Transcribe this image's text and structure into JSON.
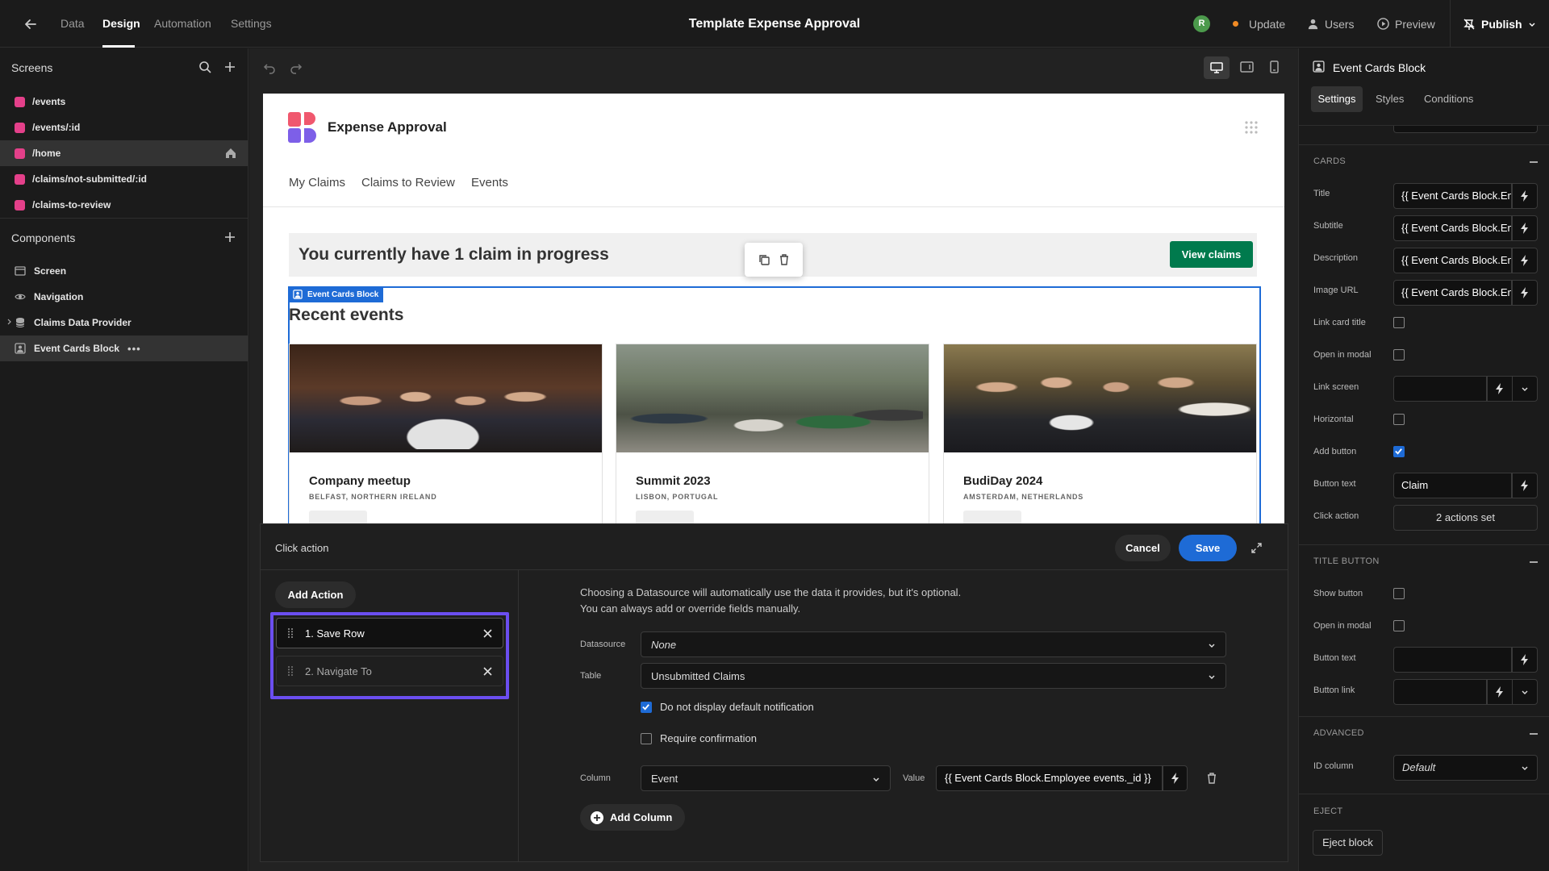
{
  "topbar": {
    "tabs": [
      "Data",
      "Design",
      "Automation",
      "Settings"
    ],
    "active_tab": "Design",
    "app_title": "Template Expense Approval",
    "avatar_initial": "R",
    "update_label": "Update",
    "users_label": "Users",
    "preview_label": "Preview",
    "publish_label": "Publish"
  },
  "screens": {
    "title": "Screens",
    "items": [
      "/events",
      "/events/:id",
      "/home",
      "/claims/not-submitted/:id",
      "/claims-to-review"
    ],
    "selected": "/home"
  },
  "components": {
    "title": "Components",
    "items": [
      "Screen",
      "Navigation",
      "Claims Data Provider",
      "Event Cards Block"
    ],
    "selected": "Event Cards Block"
  },
  "preview": {
    "app_name": "Expense Approval",
    "nav": [
      "My Claims",
      "Claims to Review",
      "Events"
    ],
    "banner_text": "You currently have 1 claim in progress",
    "view_claims_label": "View claims",
    "block_tag": "Event Cards Block",
    "section_title": "Recent events",
    "cards": [
      {
        "title": "Company meetup",
        "subtitle": "BELFAST, NORTHERN IRELAND"
      },
      {
        "title": "Summit 2023",
        "subtitle": "LISBON, PORTUGAL"
      },
      {
        "title": "BudiDay 2024",
        "subtitle": "AMSTERDAM, NETHERLANDS"
      }
    ]
  },
  "inspector": {
    "component_name": "Event Cards Block",
    "tabs": [
      "Settings",
      "Styles",
      "Conditions"
    ],
    "cards_section": "CARDS",
    "title_label": "Title",
    "title_value": "{{ Event Cards Block.Employee events.Name }}",
    "subtitle_label": "Subtitle",
    "subtitle_value": "{{ Event Cards Block.Employee events.Location }}",
    "description_label": "Description",
    "description_value": "{{ Event Cards Block.Employee events.Description }}",
    "image_label": "Image URL",
    "image_value": "{{ Event Cards Block.Employee events.Image }}",
    "link_card_title_label": "Link card title",
    "open_in_modal_label": "Open in modal",
    "link_screen_label": "Link screen",
    "horizontal_label": "Horizontal",
    "add_button_label": "Add button",
    "button_text_label": "Button text",
    "button_text_value": "Claim",
    "click_action_label": "Click action",
    "click_action_value": "2 actions set",
    "title_button_section": "TITLE BUTTON",
    "show_button_label": "Show button",
    "tb_open_in_modal_label": "Open in modal",
    "tb_button_text_label": "Button text",
    "tb_button_link_label": "Button link",
    "advanced_section": "ADVANCED",
    "id_column_label": "ID column",
    "id_column_value": "Default",
    "eject_section": "EJECT",
    "eject_button_label": "Eject block"
  },
  "modal": {
    "title": "Click action",
    "cancel_label": "Cancel",
    "save_label": "Save",
    "add_action_label": "Add Action",
    "actions": [
      "1. Save Row",
      "2. Navigate To"
    ],
    "info_line1": "Choosing a Datasource will automatically use the data it provides, but it's optional.",
    "info_line2": "You can always add or override fields manually.",
    "datasource_label": "Datasource",
    "datasource_value": "None",
    "table_label": "Table",
    "table_value": "Unsubmitted Claims",
    "no_notification_label": "Do not display default notification",
    "require_confirmation_label": "Require confirmation",
    "column_label": "Column",
    "column_value": "Event",
    "value_label": "Value",
    "value_value": "{{ Event Cards Block.Employee events._id }}",
    "add_column_label": "Add Column"
  },
  "colors": {
    "accent": "#1e6bd6",
    "highlight": "#6b4ef0",
    "view_claims": "#007a4d",
    "screen_marker": "#e4408a",
    "update_dot": "#f08a24",
    "avatar": "#4c9a4c"
  }
}
